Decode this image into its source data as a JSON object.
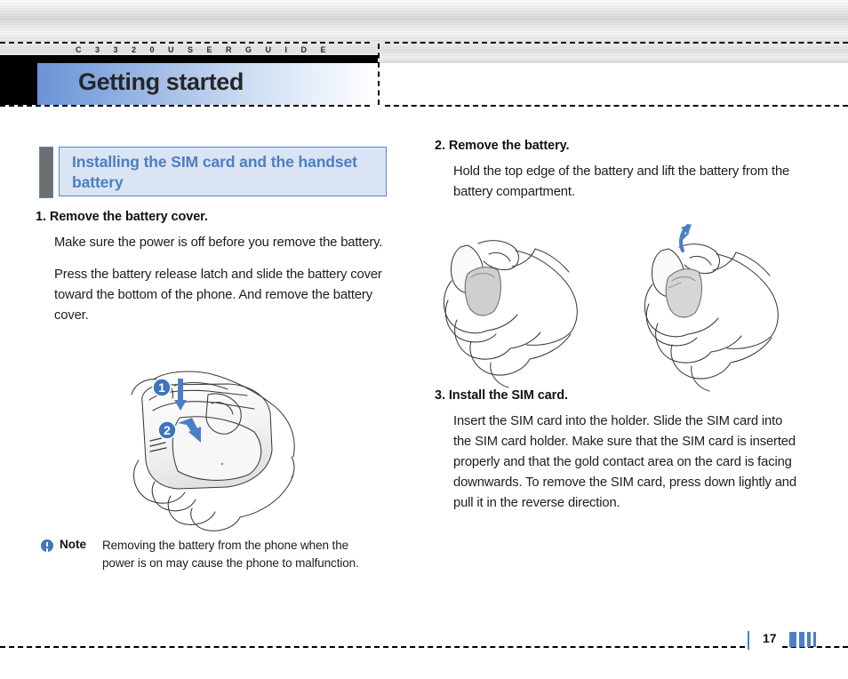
{
  "page": {
    "brand_header": "C 3 3 2 0   U S E R   G U I D E",
    "chapter_title": "Getting started",
    "page_number": "17"
  },
  "section": {
    "heading": "Installing the SIM card and the handset battery"
  },
  "steps": [
    {
      "id": "step-1",
      "heading": "1. Remove the battery cover.",
      "paragraphs": [
        "Make sure the power is off before you remove the battery.",
        "Press the battery release latch and slide the battery cover toward the bottom of the phone. And remove the battery cover."
      ]
    },
    {
      "id": "step-2",
      "heading": "2. Remove the battery.",
      "paragraphs": [
        "Hold the top edge of the battery and lift the battery from the battery compartment."
      ]
    },
    {
      "id": "step-3",
      "heading": "3. Install the SIM card.",
      "paragraphs": [
        "Insert the SIM card into the holder. Slide the SIM card into the SIM card holder. Make sure that the SIM card is inserted properly and that the gold contact area on the card is facing downwards. To remove the SIM card, press down lightly and pull it in the reverse direction."
      ]
    }
  ],
  "note": {
    "icon": "info-exclamation-icon",
    "label": "Note",
    "text": "Removing the battery from the phone when the power is on may cause the phone to malfunction."
  },
  "illustrations": {
    "left": {
      "name": "hand-removing-battery-cover-illustration",
      "callouts": [
        "1",
        "2"
      ]
    },
    "right_first": {
      "name": "hand-holding-phone-battery-illustration"
    },
    "right_second": {
      "name": "hand-lifting-battery-illustration"
    }
  },
  "colors": {
    "accent_blue": "#4b7ec4",
    "callout_blue": "#3f74bd",
    "heading_box_fill": "#dae4f3",
    "heading_box_border": "#5b86c4",
    "title_band_blue": "#6b93d6",
    "note_icon_blue": "#4277bd",
    "footer_blue": "#4d7fc6"
  },
  "footer": {
    "bar_widths": [
      8,
      6,
      4,
      3
    ]
  }
}
